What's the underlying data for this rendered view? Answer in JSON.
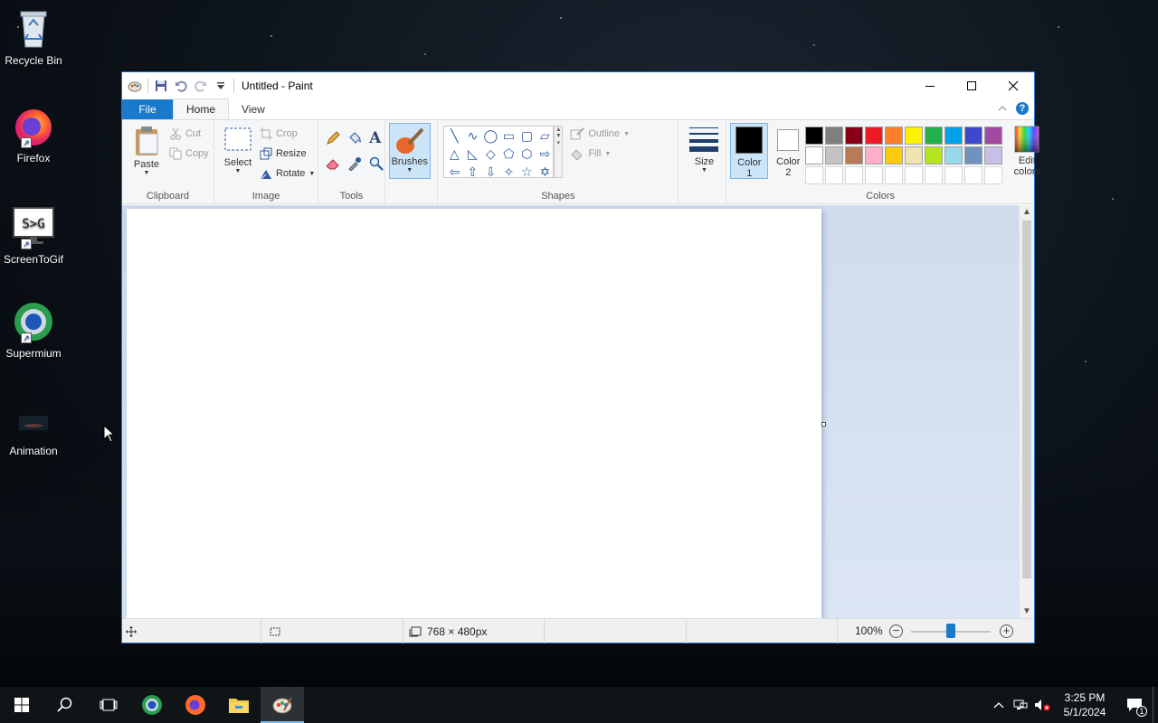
{
  "desktop": {
    "icons": [
      {
        "label": "Recycle Bin"
      },
      {
        "label": "Firefox"
      },
      {
        "label": "ScreenToGif",
        "thumb_text": "S>G"
      },
      {
        "label": "Supermium"
      },
      {
        "label": "Animation"
      }
    ]
  },
  "window": {
    "title": "Untitled - Paint",
    "tabs": [
      "File",
      "Home",
      "View"
    ],
    "clipboard": {
      "paste": "Paste",
      "cut": "Cut",
      "copy": "Copy",
      "label": "Clipboard"
    },
    "image": {
      "select": "Select",
      "crop": "Crop",
      "resize": "Resize",
      "rotate": "Rotate",
      "label": "Image"
    },
    "tools": {
      "label": "Tools"
    },
    "brushes": {
      "label": "Brushes"
    },
    "shapes": {
      "outline": "Outline",
      "fill": "Fill",
      "label": "Shapes"
    },
    "size": {
      "label": "Size"
    },
    "colors": {
      "color1": "Color",
      "color1_num": "1",
      "color2": "Color",
      "color2_num": "2",
      "edit1": "Edit",
      "edit2": "colors",
      "label": "Colors",
      "color1_value": "#000000",
      "color2_value": "#ffffff",
      "palette_row1": [
        "#000000",
        "#7f7f7f",
        "#880015",
        "#ed1c24",
        "#ff7f27",
        "#fff200",
        "#22b14c",
        "#00a2e8",
        "#3f48cc",
        "#a349a4"
      ],
      "palette_row2": [
        "#ffffff",
        "#c3c3c3",
        "#b97a57",
        "#ffaec9",
        "#ffc90e",
        "#efe4b0",
        "#b5e61d",
        "#99d9ea",
        "#7092be",
        "#c8bfe7"
      ]
    },
    "status": {
      "dimensions": "768 × 480px",
      "zoom": "100%"
    }
  },
  "taskbar": {
    "time": "3:25 PM",
    "date": "5/1/2024",
    "notifications": "1"
  }
}
